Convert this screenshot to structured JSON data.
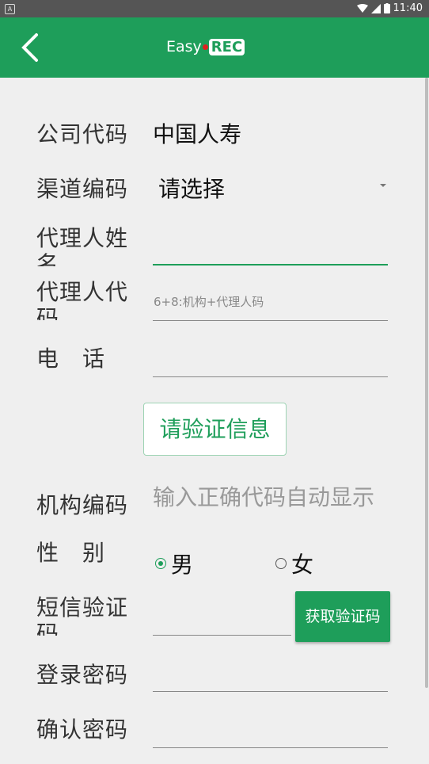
{
  "status_bar": {
    "time": "11:40",
    "notification_icon": "A"
  },
  "app_bar": {
    "logo_text": "Easy",
    "logo_badge": "REC"
  },
  "form": {
    "company_code": {
      "label": "公司代码",
      "value": "中国人寿"
    },
    "channel_code": {
      "label": "渠道编码",
      "value": "请选择"
    },
    "agent_name": {
      "label": "代理人姓名",
      "value": ""
    },
    "agent_code": {
      "label": "代理人代码",
      "placeholder": "6+8:机构+代理人码"
    },
    "phone": {
      "label": "电　话",
      "value": ""
    },
    "verify_button": "请验证信息",
    "org_code": {
      "label": "机构编码",
      "placeholder": "输入正确代码自动显示"
    },
    "gender": {
      "label": "性　别",
      "options": [
        "男",
        "女"
      ],
      "selected": "男"
    },
    "sms_code": {
      "label": "短信验证码",
      "button": "获取验证码"
    },
    "login_password": {
      "label": "登录密码"
    },
    "confirm_password": {
      "label": "确认密码"
    }
  },
  "colors": {
    "primary": "#1e9e5a",
    "status_bar": "#555555",
    "background": "#efefef"
  }
}
